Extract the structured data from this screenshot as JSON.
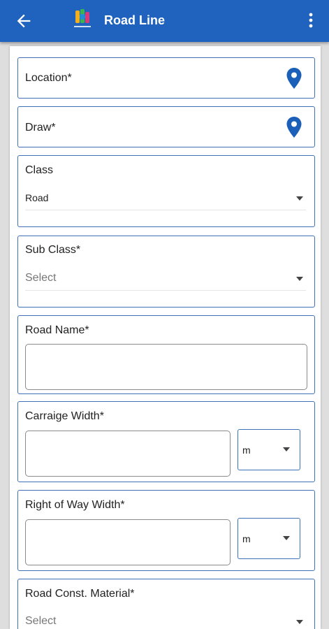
{
  "app_bar": {
    "title": "Road Line",
    "back_icon": "arrow-left-icon",
    "logo_icon": "app-logo",
    "menu_icon": "more-vertical-icon",
    "color": "#1f63bf"
  },
  "form": {
    "location": {
      "label": "Location*",
      "icon": "location-pin-icon"
    },
    "draw": {
      "label": "Draw*",
      "icon": "location-pin-icon"
    },
    "class": {
      "label": "Class",
      "value": "Road"
    },
    "sub_class": {
      "label": "Sub Class*",
      "placeholder": "Select"
    },
    "road_name": {
      "label": "Road Name*",
      "value": ""
    },
    "carriage_width": {
      "label": "Carraige Width*",
      "value": "",
      "unit": "m"
    },
    "right_of_way_width": {
      "label": "Right of Way Width*",
      "value": "",
      "unit": "m"
    },
    "road_const_material": {
      "label": "Road Const. Material*",
      "placeholder": "Select"
    }
  },
  "colors": {
    "accent": "#1f63bf",
    "border": "#3e72b8",
    "pin": "#1b5fb8"
  }
}
